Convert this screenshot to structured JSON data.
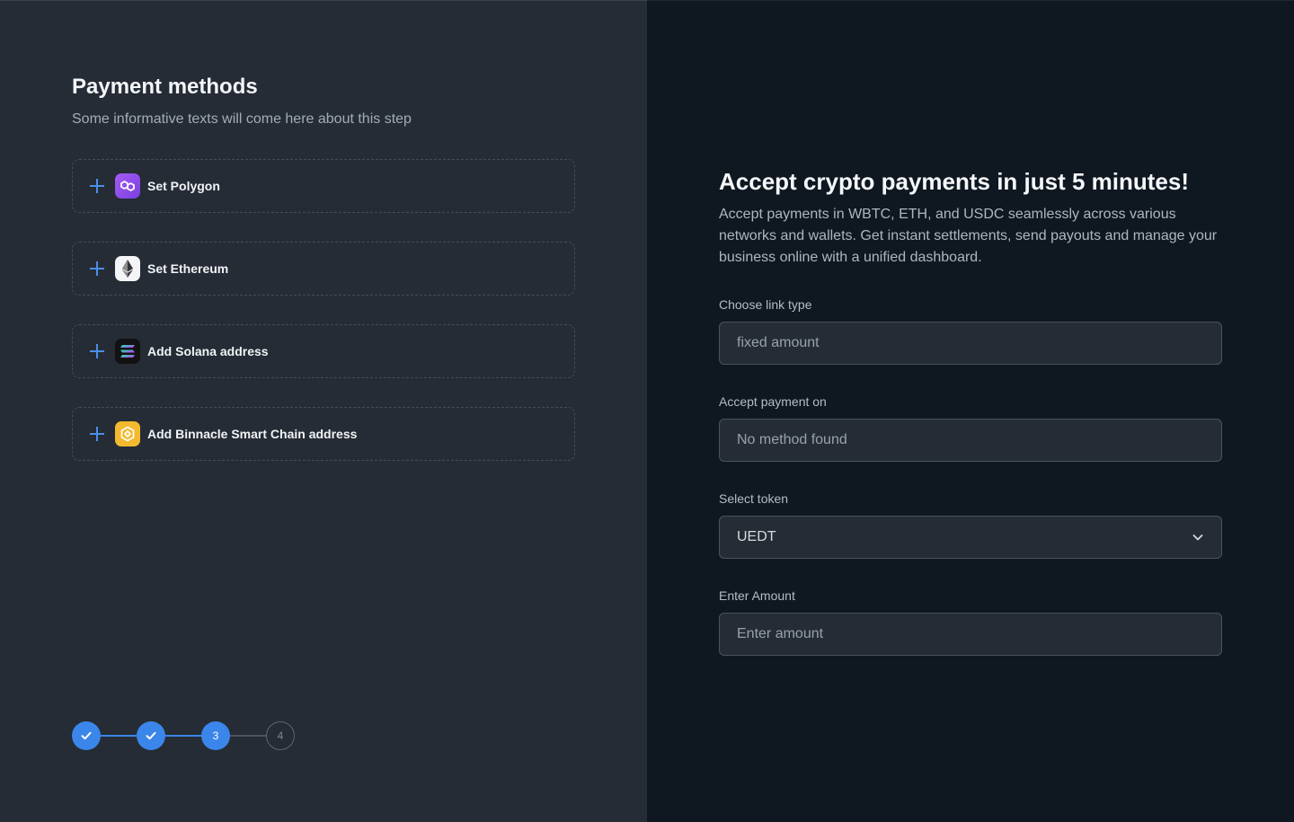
{
  "left": {
    "title": "Payment methods",
    "subtitle": "Some informative texts will come here about this step",
    "methods": [
      {
        "label": "Set Polygon",
        "icon": "polygon-icon"
      },
      {
        "label": "Set Ethereum",
        "icon": "ethereum-icon"
      },
      {
        "label": "Add Solana address",
        "icon": "solana-icon"
      },
      {
        "label": "Add Binnacle Smart Chain address",
        "icon": "bnb-icon"
      }
    ],
    "stepper": {
      "steps": [
        {
          "label": "",
          "state": "done"
        },
        {
          "label": "",
          "state": "done"
        },
        {
          "label": "3",
          "state": "active"
        },
        {
          "label": "4",
          "state": "todo"
        }
      ],
      "accent": "#3b86ea"
    }
  },
  "right": {
    "title": "Accept crypto payments in just 5 minutes!",
    "description": "Accept payments in WBTC, ETH, and USDC seamlessly across various networks and wallets. Get instant settlements, send payouts and manage your business online with a unified dashboard.",
    "form": {
      "link_type": {
        "label": "Choose link type",
        "value": "fixed amount"
      },
      "accept_on": {
        "label": "Accept payment on",
        "value": "No method found"
      },
      "token": {
        "label": "Select token",
        "value": "UEDT"
      },
      "amount": {
        "label": "Enter Amount",
        "placeholder": "Enter amount"
      }
    }
  },
  "colors": {
    "left_bg": "#252c35",
    "right_bg": "#0f1720",
    "accent": "#3b86ea"
  }
}
